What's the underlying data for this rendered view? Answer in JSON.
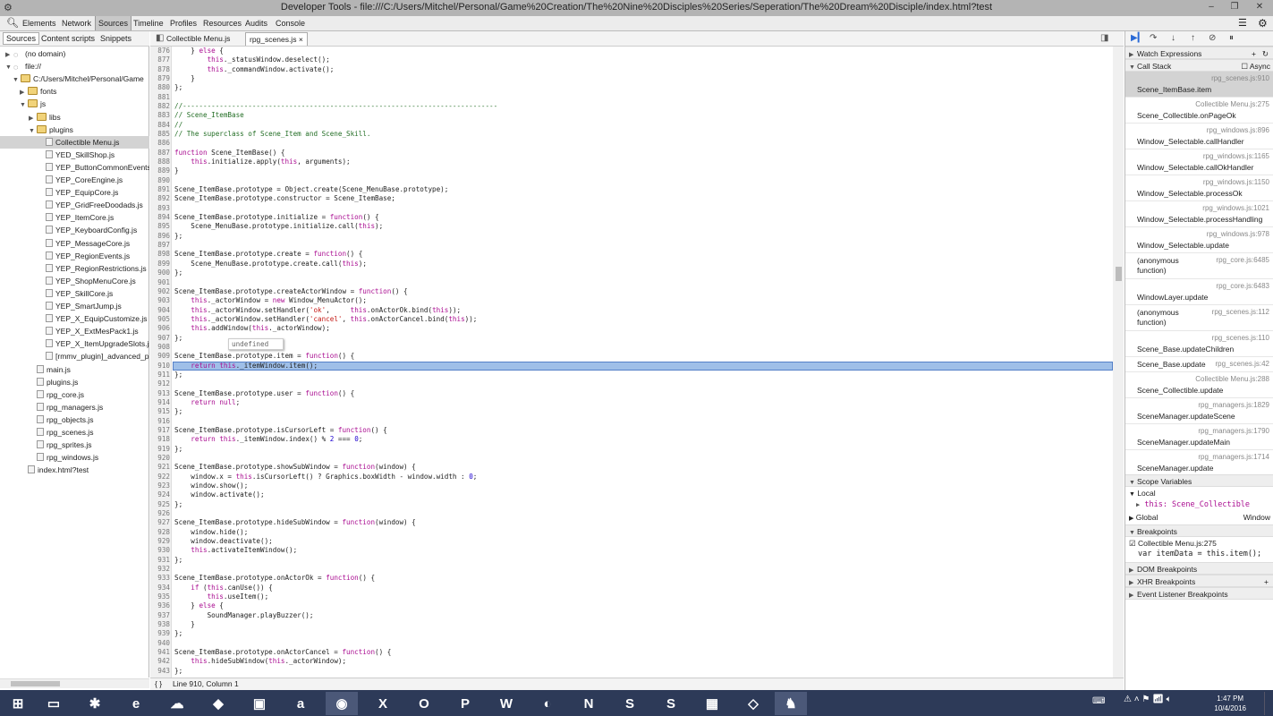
{
  "window": {
    "title": "Developer Tools - file:///C:/Users/Mitchel/Personal/Game%20Creation/The%20Nine%20Disciples%20Series/Seperation/The%20Dream%20Disciple/index.html?test",
    "minimize": "–",
    "restore": "❐",
    "close": "✕"
  },
  "toolbar": {
    "tabs": [
      "Elements",
      "Network",
      "Sources",
      "Timeline",
      "Profiles",
      "Resources",
      "Audits",
      "Console"
    ],
    "active": "Sources"
  },
  "navigator": {
    "tabs": [
      "Sources",
      "Content scripts",
      "Snippets"
    ],
    "tree": [
      {
        "label": "(no domain)",
        "depth": 0,
        "type": "origin",
        "arrow": "▶"
      },
      {
        "label": "file://",
        "depth": 0,
        "type": "origin",
        "arrow": "▼"
      },
      {
        "label": "C:/Users/Mitchel/Personal/Game",
        "depth": 1,
        "type": "folder",
        "arrow": "▼"
      },
      {
        "label": "fonts",
        "depth": 2,
        "type": "folder",
        "arrow": "▶"
      },
      {
        "label": "js",
        "depth": 2,
        "type": "folder",
        "arrow": "▼"
      },
      {
        "label": "libs",
        "depth": 3,
        "type": "folder",
        "arrow": "▶"
      },
      {
        "label": "plugins",
        "depth": 3,
        "type": "folder",
        "arrow": "▼"
      },
      {
        "label": "Collectible Menu.js",
        "depth": 4,
        "type": "file",
        "selected": true
      },
      {
        "label": "YED_SkillShop.js",
        "depth": 4,
        "type": "file"
      },
      {
        "label": "YEP_ButtonCommonEvents",
        "depth": 4,
        "type": "file"
      },
      {
        "label": "YEP_CoreEngine.js",
        "depth": 4,
        "type": "file"
      },
      {
        "label": "YEP_EquipCore.js",
        "depth": 4,
        "type": "file"
      },
      {
        "label": "YEP_GridFreeDoodads.js",
        "depth": 4,
        "type": "file"
      },
      {
        "label": "YEP_ItemCore.js",
        "depth": 4,
        "type": "file"
      },
      {
        "label": "YEP_KeyboardConfig.js",
        "depth": 4,
        "type": "file"
      },
      {
        "label": "YEP_MessageCore.js",
        "depth": 4,
        "type": "file"
      },
      {
        "label": "YEP_RegionEvents.js",
        "depth": 4,
        "type": "file"
      },
      {
        "label": "YEP_RegionRestrictions.js",
        "depth": 4,
        "type": "file"
      },
      {
        "label": "YEP_ShopMenuCore.js",
        "depth": 4,
        "type": "file"
      },
      {
        "label": "YEP_SkillCore.js",
        "depth": 4,
        "type": "file"
      },
      {
        "label": "YEP_SmartJump.js",
        "depth": 4,
        "type": "file"
      },
      {
        "label": "YEP_X_EquipCustomize.js",
        "depth": 4,
        "type": "file"
      },
      {
        "label": "YEP_X_ExtMesPack1.js",
        "depth": 4,
        "type": "file"
      },
      {
        "label": "YEP_X_ItemUpgradeSlots.js",
        "depth": 4,
        "type": "file"
      },
      {
        "label": "[rmmv_plugin]_advanced_p",
        "depth": 4,
        "type": "file"
      },
      {
        "label": "main.js",
        "depth": 3,
        "type": "file"
      },
      {
        "label": "plugins.js",
        "depth": 3,
        "type": "file"
      },
      {
        "label": "rpg_core.js",
        "depth": 3,
        "type": "file"
      },
      {
        "label": "rpg_managers.js",
        "depth": 3,
        "type": "file"
      },
      {
        "label": "rpg_objects.js",
        "depth": 3,
        "type": "file"
      },
      {
        "label": "rpg_scenes.js",
        "depth": 3,
        "type": "file"
      },
      {
        "label": "rpg_sprites.js",
        "depth": 3,
        "type": "file"
      },
      {
        "label": "rpg_windows.js",
        "depth": 3,
        "type": "file"
      },
      {
        "label": "index.html?test",
        "depth": 2,
        "type": "file"
      }
    ]
  },
  "editor": {
    "tabs": [
      "Collectible Menu.js",
      "rpg_scenes.js"
    ],
    "active_tab": "rpg_scenes.js",
    "tab_close": "×",
    "first_line": 876,
    "current_line": 910,
    "tooltip": "undefined",
    "lines": [
      "    } else {",
      "        this._statusWindow.deselect();",
      "        this._commandWindow.activate();",
      "    }",
      "};",
      "",
      "//-----------------------------------------------------------------------------",
      "// Scene_ItemBase",
      "//",
      "// The superclass of Scene_Item and Scene_Skill.",
      "",
      "function Scene_ItemBase() {",
      "    this.initialize.apply(this, arguments);",
      "}",
      "",
      "Scene_ItemBase.prototype = Object.create(Scene_MenuBase.prototype);",
      "Scene_ItemBase.prototype.constructor = Scene_ItemBase;",
      "",
      "Scene_ItemBase.prototype.initialize = function() {",
      "    Scene_MenuBase.prototype.initialize.call(this);",
      "};",
      "",
      "Scene_ItemBase.prototype.create = function() {",
      "    Scene_MenuBase.prototype.create.call(this);",
      "};",
      "",
      "Scene_ItemBase.prototype.createActorWindow = function() {",
      "    this._actorWindow = new Window_MenuActor();",
      "    this._actorWindow.setHandler('ok',     this.onActorOk.bind(this));",
      "    this._actorWindow.setHandler('cancel', this.onActorCancel.bind(this));",
      "    this.addWindow(this._actorWindow);",
      "};",
      "",
      "Scene_ItemBase.prototype.item = function() {",
      "    return this._itemWindow.item();",
      "};",
      "",
      "Scene_ItemBase.prototype.user = function() {",
      "    return null;",
      "};",
      "",
      "Scene_ItemBase.prototype.isCursorLeft = function() {",
      "    return this._itemWindow.index() % 2 === 0;",
      "};",
      "",
      "Scene_ItemBase.prototype.showSubWindow = function(window) {",
      "    window.x = this.isCursorLeft() ? Graphics.boxWidth - window.width : 0;",
      "    window.show();",
      "    window.activate();",
      "};",
      "",
      "Scene_ItemBase.prototype.hideSubWindow = function(window) {",
      "    window.hide();",
      "    window.deactivate();",
      "    this.activateItemWindow();",
      "};",
      "",
      "Scene_ItemBase.prototype.onActorOk = function() {",
      "    if (this.canUse()) {",
      "        this.useItem();",
      "    } else {",
      "        SoundManager.playBuzzer();",
      "    }",
      "};",
      "",
      "Scene_ItemBase.prototype.onActorCancel = function() {",
      "    this.hideSubWindow(this._actorWindow);",
      "};"
    ]
  },
  "status_bar": {
    "braces": "{ }",
    "position": "Line 910, Column 1"
  },
  "debugger": {
    "watch_label": "Watch Expressions",
    "callstack_label": "Call Stack",
    "async_label": "Async",
    "frames": [
      {
        "fn": "Scene_ItemBase.item",
        "loc": "rpg_scenes.js:910",
        "selected": true
      },
      {
        "fn": "Scene_Collectible.onPageOk",
        "loc": "Collectible Menu.js:275"
      },
      {
        "fn": "Window_Selectable.callHandler",
        "loc": "rpg_windows.js:896"
      },
      {
        "fn": "Window_Selectable.callOkHandler",
        "loc": "rpg_windows.js:1165"
      },
      {
        "fn": "Window_Selectable.processOk",
        "loc": "rpg_windows.js:1150"
      },
      {
        "fn": "Window_Selectable.processHandling",
        "loc": "rpg_windows.js:1021"
      },
      {
        "fn": "Window_Selectable.update",
        "loc": "rpg_windows.js:978"
      },
      {
        "fn": "(anonymous function)",
        "loc": "rpg_core.js:6485"
      },
      {
        "fn": "WindowLayer.update",
        "loc": "rpg_core.js:6483"
      },
      {
        "fn": "(anonymous function)",
        "loc": "rpg_scenes.js:112"
      },
      {
        "fn": "Scene_Base.updateChildren",
        "loc": "rpg_scenes.js:110"
      },
      {
        "fn": "Scene_Base.update",
        "loc": "rpg_scenes.js:42",
        "inline": true
      },
      {
        "fn": "Scene_Collectible.update",
        "loc": "Collectible Menu.js:288"
      },
      {
        "fn": "SceneManager.updateScene",
        "loc": "rpg_managers.js:1829"
      },
      {
        "fn": "SceneManager.updateMain",
        "loc": "rpg_managers.js:1790"
      },
      {
        "fn": "SceneManager.update",
        "loc": "rpg_managers.js:1714"
      }
    ],
    "scope_label": "Scope Variables",
    "local_label": "Local",
    "this_label": "this: Scene_Collectible",
    "global_label": "Global",
    "global_value": "Window",
    "breakpoints_label": "Breakpoints",
    "bp_file": "Collectible Menu.js:275",
    "bp_code": "var itemData = this.item();",
    "dom_bp": "DOM Breakpoints",
    "xhr_bp": "XHR Breakpoints",
    "event_bp": "Event Listener Breakpoints"
  },
  "taskbar": {
    "time": "1:47 PM",
    "date": "10/4/2016"
  },
  "colors": {
    "keyword": "#aa0d91",
    "string": "#c41a16",
    "comment": "#236e25",
    "number": "#1c00cf",
    "highlight": "#9fbfe8",
    "taskbar": "#2d3a58"
  }
}
